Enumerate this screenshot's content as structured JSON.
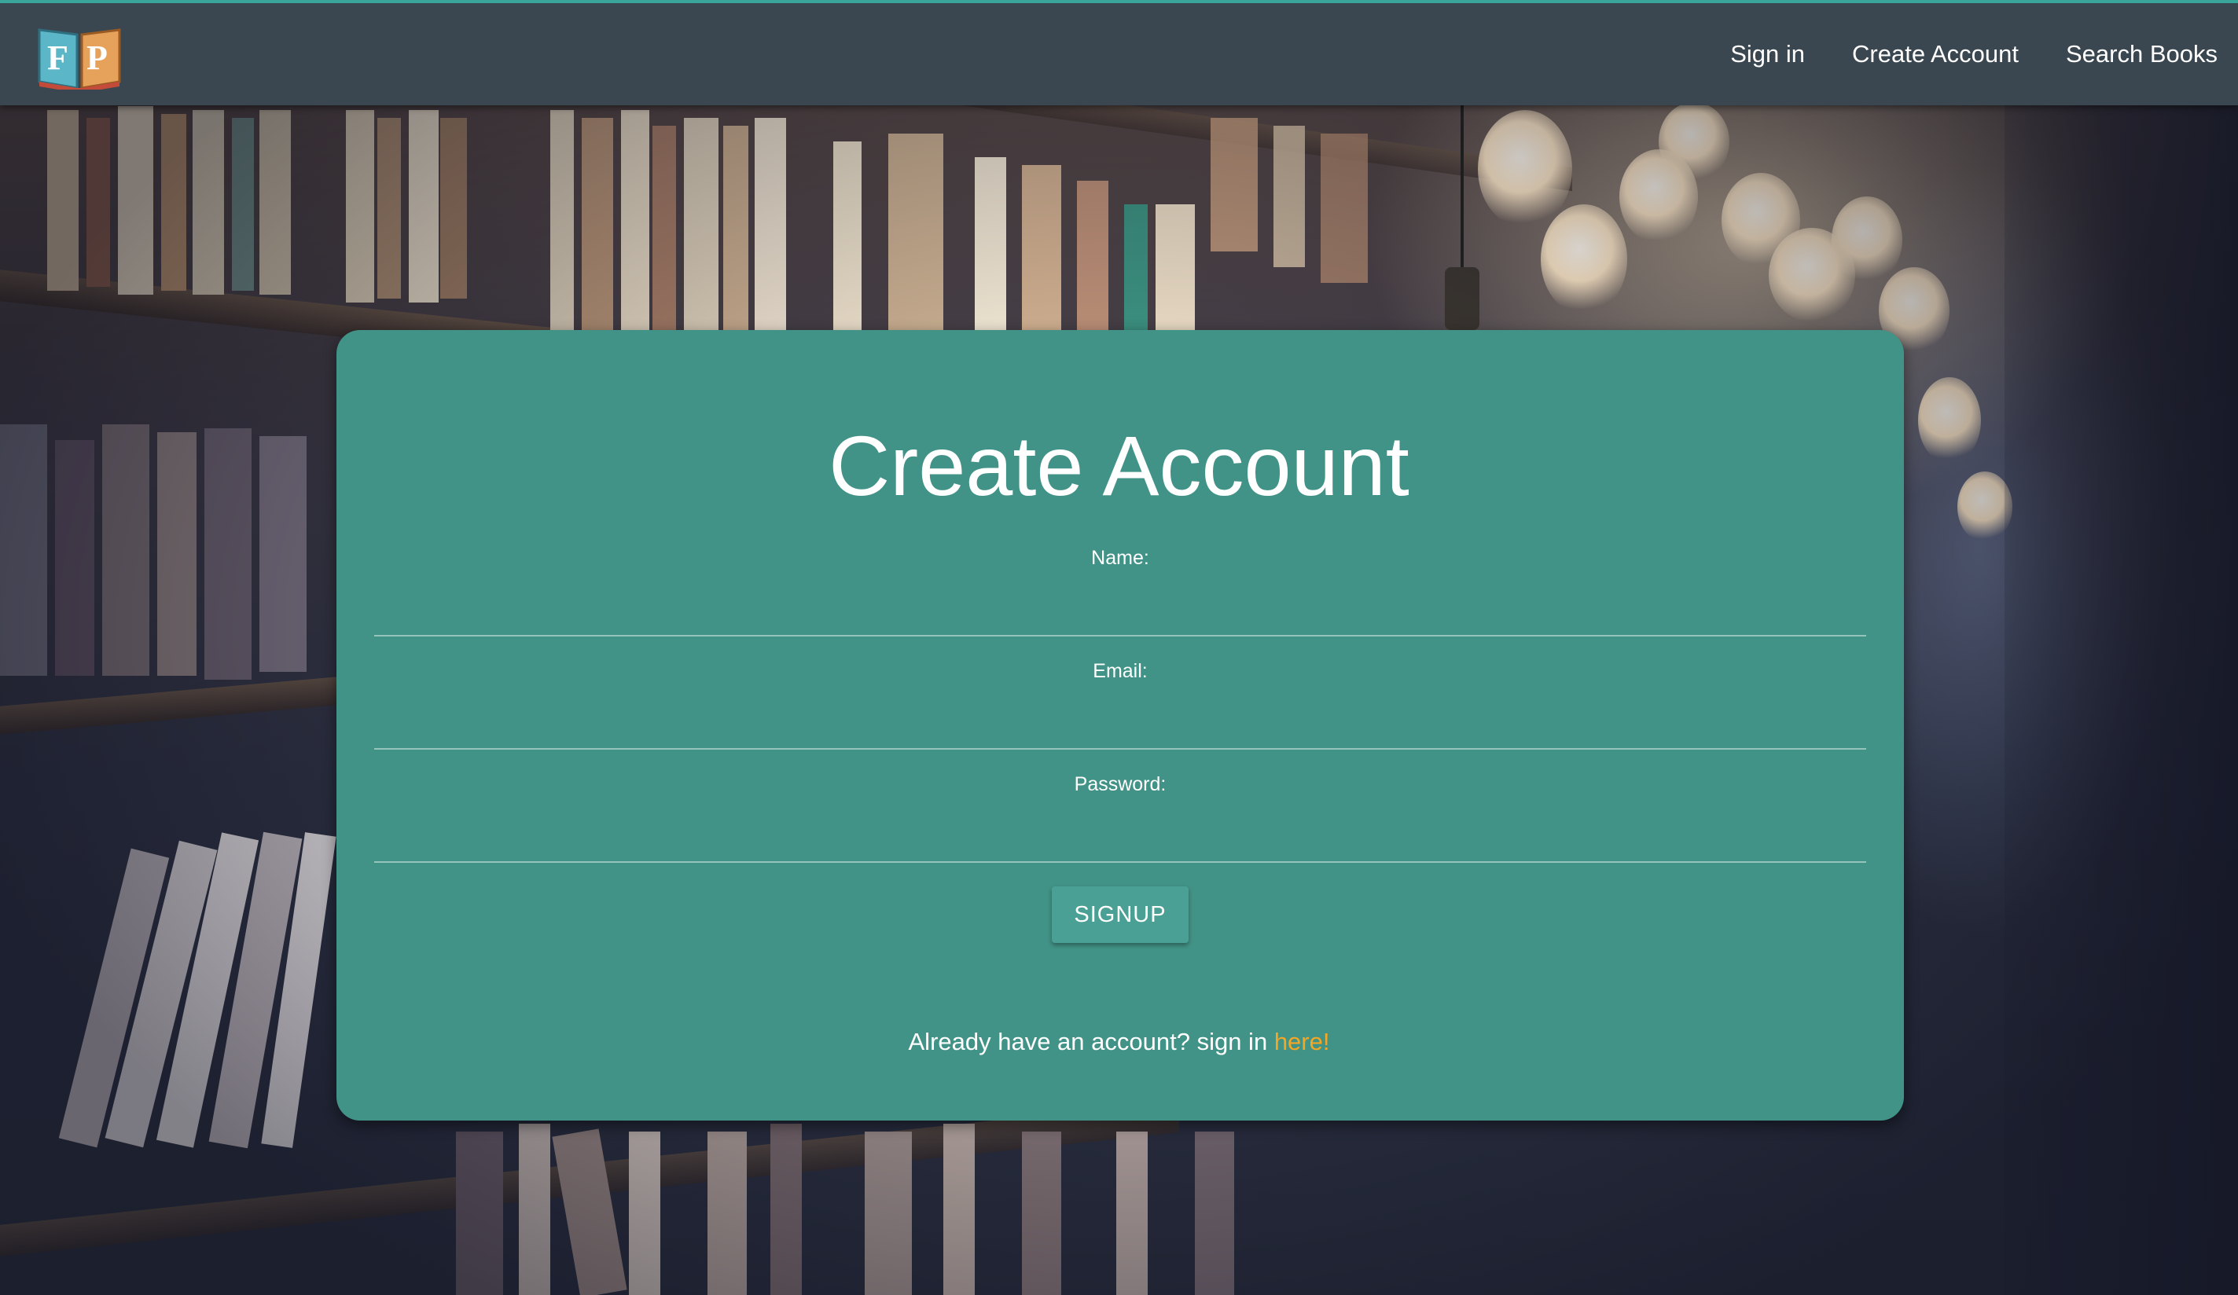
{
  "nav": {
    "logo_letters": "FP",
    "links": [
      "Sign in",
      "Create Account",
      "Search Books"
    ]
  },
  "form": {
    "title": "Create Account",
    "fields": [
      {
        "label": "Name:",
        "value": "",
        "placeholder": ""
      },
      {
        "label": "Email:",
        "value": "",
        "placeholder": ""
      },
      {
        "label": "Password:",
        "value": "",
        "placeholder": ""
      }
    ],
    "submit_label": "SIGNUP",
    "footer_text": "Already have an account? sign in ",
    "footer_link": "here!"
  },
  "colors": {
    "navbar": "#3a4750",
    "card": "#429387",
    "accent_link": "#f5a623",
    "button": "#4aa094"
  }
}
